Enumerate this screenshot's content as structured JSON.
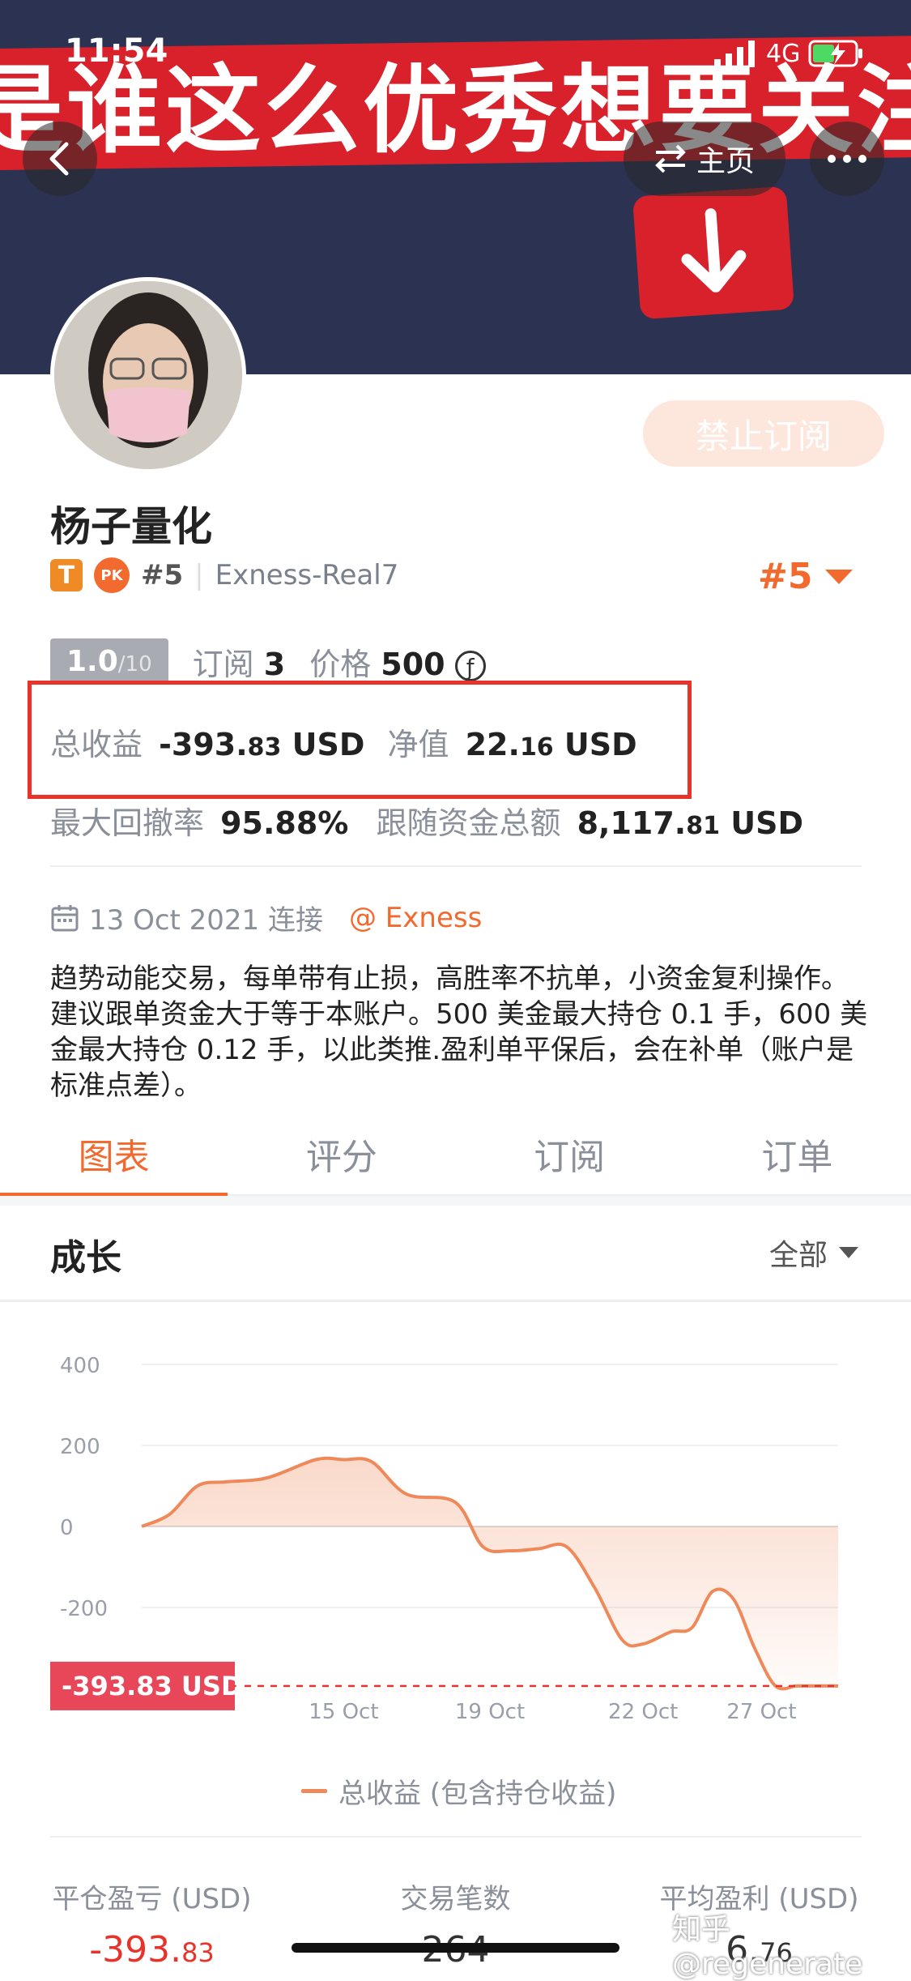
{
  "status_bar": {
    "time": "11:54",
    "network": "4G"
  },
  "banner": {
    "text": "是谁这么优秀想要关注我",
    "arrow": "↓"
  },
  "nav": {
    "home_label": "主页"
  },
  "profile": {
    "name": "杨子量化",
    "subscribe_label": "禁止订阅",
    "badge_t": "T",
    "badge_pk": "PK",
    "rank": "#5",
    "account": "Exness-Real7",
    "rank_right": "#5"
  },
  "stats": {
    "score": "1.0",
    "score_max": "/10",
    "subscriptions_label": "订阅",
    "subscriptions_value": "3",
    "price_label": "价格",
    "price_value": "500",
    "price_icon": "ƒ",
    "total_profit_label": "总收益",
    "total_profit_int": "-393.",
    "total_profit_dec": "83",
    "total_profit_unit": "USD",
    "equity_label": "净值",
    "equity_int": "22.",
    "equity_dec": "16",
    "equity_unit": "USD",
    "max_drawdown_label": "最大回撤率",
    "max_drawdown_value": "95.88%",
    "follow_funds_label": "跟随资金总额",
    "follow_funds_int": "8,117.",
    "follow_funds_dec": "81",
    "follow_funds_unit": "USD"
  },
  "joined": {
    "date": "13 Oct 2021 连接",
    "broker": "@ Exness"
  },
  "bio": "趋势动能交易，每单带有止损，高胜率不抗单，小资金复利操作。建议跟单资金大于等于本账户。500 美金最大持仓 0.1 手，600 美金最大持仓 0.12 手，以此类推.盈利单平保后，会在补单（账户是标准点差）。",
  "tabs": [
    {
      "label": "图表",
      "active": true
    },
    {
      "label": "评分",
      "active": false
    },
    {
      "label": "订阅",
      "active": false
    },
    {
      "label": "订单",
      "active": false
    }
  ],
  "growth": {
    "title": "成长",
    "filter": "全部"
  },
  "colors": {
    "accent": "#f26a2e",
    "line": "#f0895a",
    "red": "#e8332a"
  },
  "chart_data": {
    "type": "area",
    "y_ticks": [
      "400",
      "200",
      "0",
      "-200"
    ],
    "x_ticks": [
      "15 Oct",
      "19 Oct",
      "22 Oct",
      "27 Oct"
    ],
    "ylim": [
      -400,
      400
    ],
    "grid": true,
    "current_value_label": "-393.83 USD",
    "current_value": -393.83,
    "series": [
      {
        "name": "总收益 (包含持仓收益)",
        "x": [
          0.0,
          0.04,
          0.08,
          0.12,
          0.18,
          0.25,
          0.29,
          0.33,
          0.38,
          0.45,
          0.49,
          0.53,
          0.57,
          0.61,
          0.65,
          0.69,
          0.72,
          0.76,
          0.79,
          0.82,
          0.85,
          0.88,
          0.91,
          0.94,
          0.96,
          1.0
        ],
        "y": [
          0,
          30,
          100,
          110,
          120,
          165,
          165,
          160,
          80,
          60,
          -50,
          -60,
          -55,
          -50,
          -150,
          -280,
          -290,
          -260,
          -250,
          -160,
          -180,
          -300,
          -393.83,
          -393.83,
          -393.83,
          -393.83
        ]
      }
    ],
    "legend": "总收益 (包含持仓收益)"
  },
  "bottom_stats": [
    {
      "label": "平仓盈亏 (USD)",
      "value_int": "-393.",
      "value_dec": "83",
      "red": true
    },
    {
      "label": "交易笔数",
      "value_int": "264",
      "value_dec": "",
      "red": false
    },
    {
      "label": "平均盈利 (USD)",
      "value_int": "6.",
      "value_dec": "76",
      "red": false
    }
  ],
  "watermark": "知乎 @regenerate"
}
